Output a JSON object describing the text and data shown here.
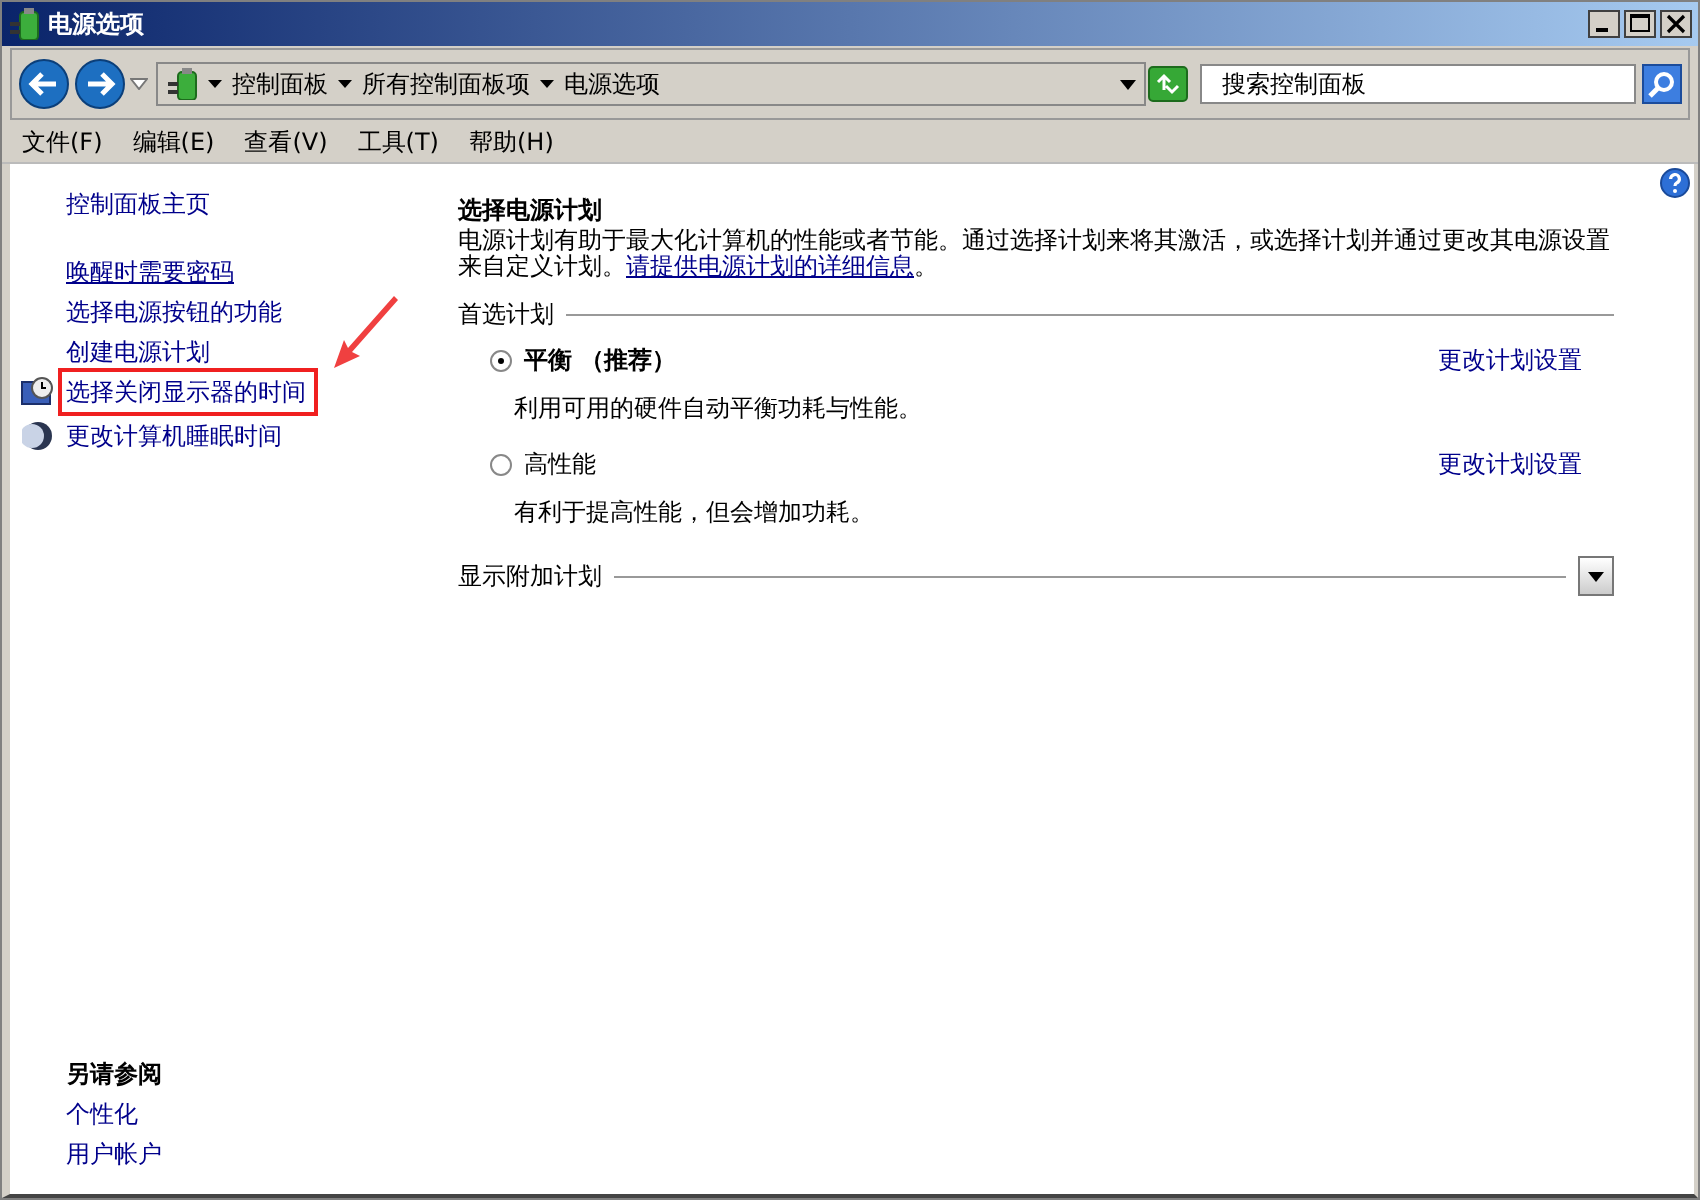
{
  "window": {
    "title": "电源选项"
  },
  "address_bar": {
    "breadcrumbs": [
      "控制面板",
      "所有控制面板项",
      "电源选项"
    ]
  },
  "search": {
    "placeholder": "搜索控制面板"
  },
  "menu": [
    "文件(F)",
    "编辑(E)",
    "查看(V)",
    "工具(T)",
    "帮助(H)"
  ],
  "sidebar": {
    "home": "控制面板主页",
    "tasks": [
      {
        "label": "唤醒时需要密码",
        "kind": "plain",
        "hovered": true,
        "highlighted": false
      },
      {
        "label": "选择电源按钮的功能",
        "kind": "plain",
        "hovered": false,
        "highlighted": false
      },
      {
        "label": "创建电源计划",
        "kind": "plain",
        "hovered": false,
        "highlighted": false
      },
      {
        "label": "选择关闭显示器的时间",
        "kind": "display",
        "hovered": false,
        "highlighted": true
      },
      {
        "label": "更改计算机睡眠时间",
        "kind": "sleep",
        "hovered": false,
        "highlighted": false
      }
    ],
    "see_also": {
      "title": "另请参阅",
      "links": [
        "个性化",
        "用户帐户"
      ]
    }
  },
  "main": {
    "title": "选择电源计划",
    "description": "电源计划有助于最大化计算机的性能或者节能。通过选择计划来将其激活，或选择计划并通过更改其电源设置来自定义计划。",
    "description_link": "请提供电源计划的详细信息",
    "description_end": "。",
    "preferred": {
      "title": "首选计划",
      "plans": [
        {
          "name": "平衡 （推荐）",
          "selected": true,
          "description": "利用可用的硬件自动平衡功耗与性能。",
          "action": "更改计划设置"
        },
        {
          "name": "高性能",
          "selected": false,
          "description": "有利于提高性能，但会增加功耗。",
          "action": "更改计划设置"
        }
      ]
    },
    "additional": {
      "title": "显示附加计划",
      "expanded": false
    }
  }
}
